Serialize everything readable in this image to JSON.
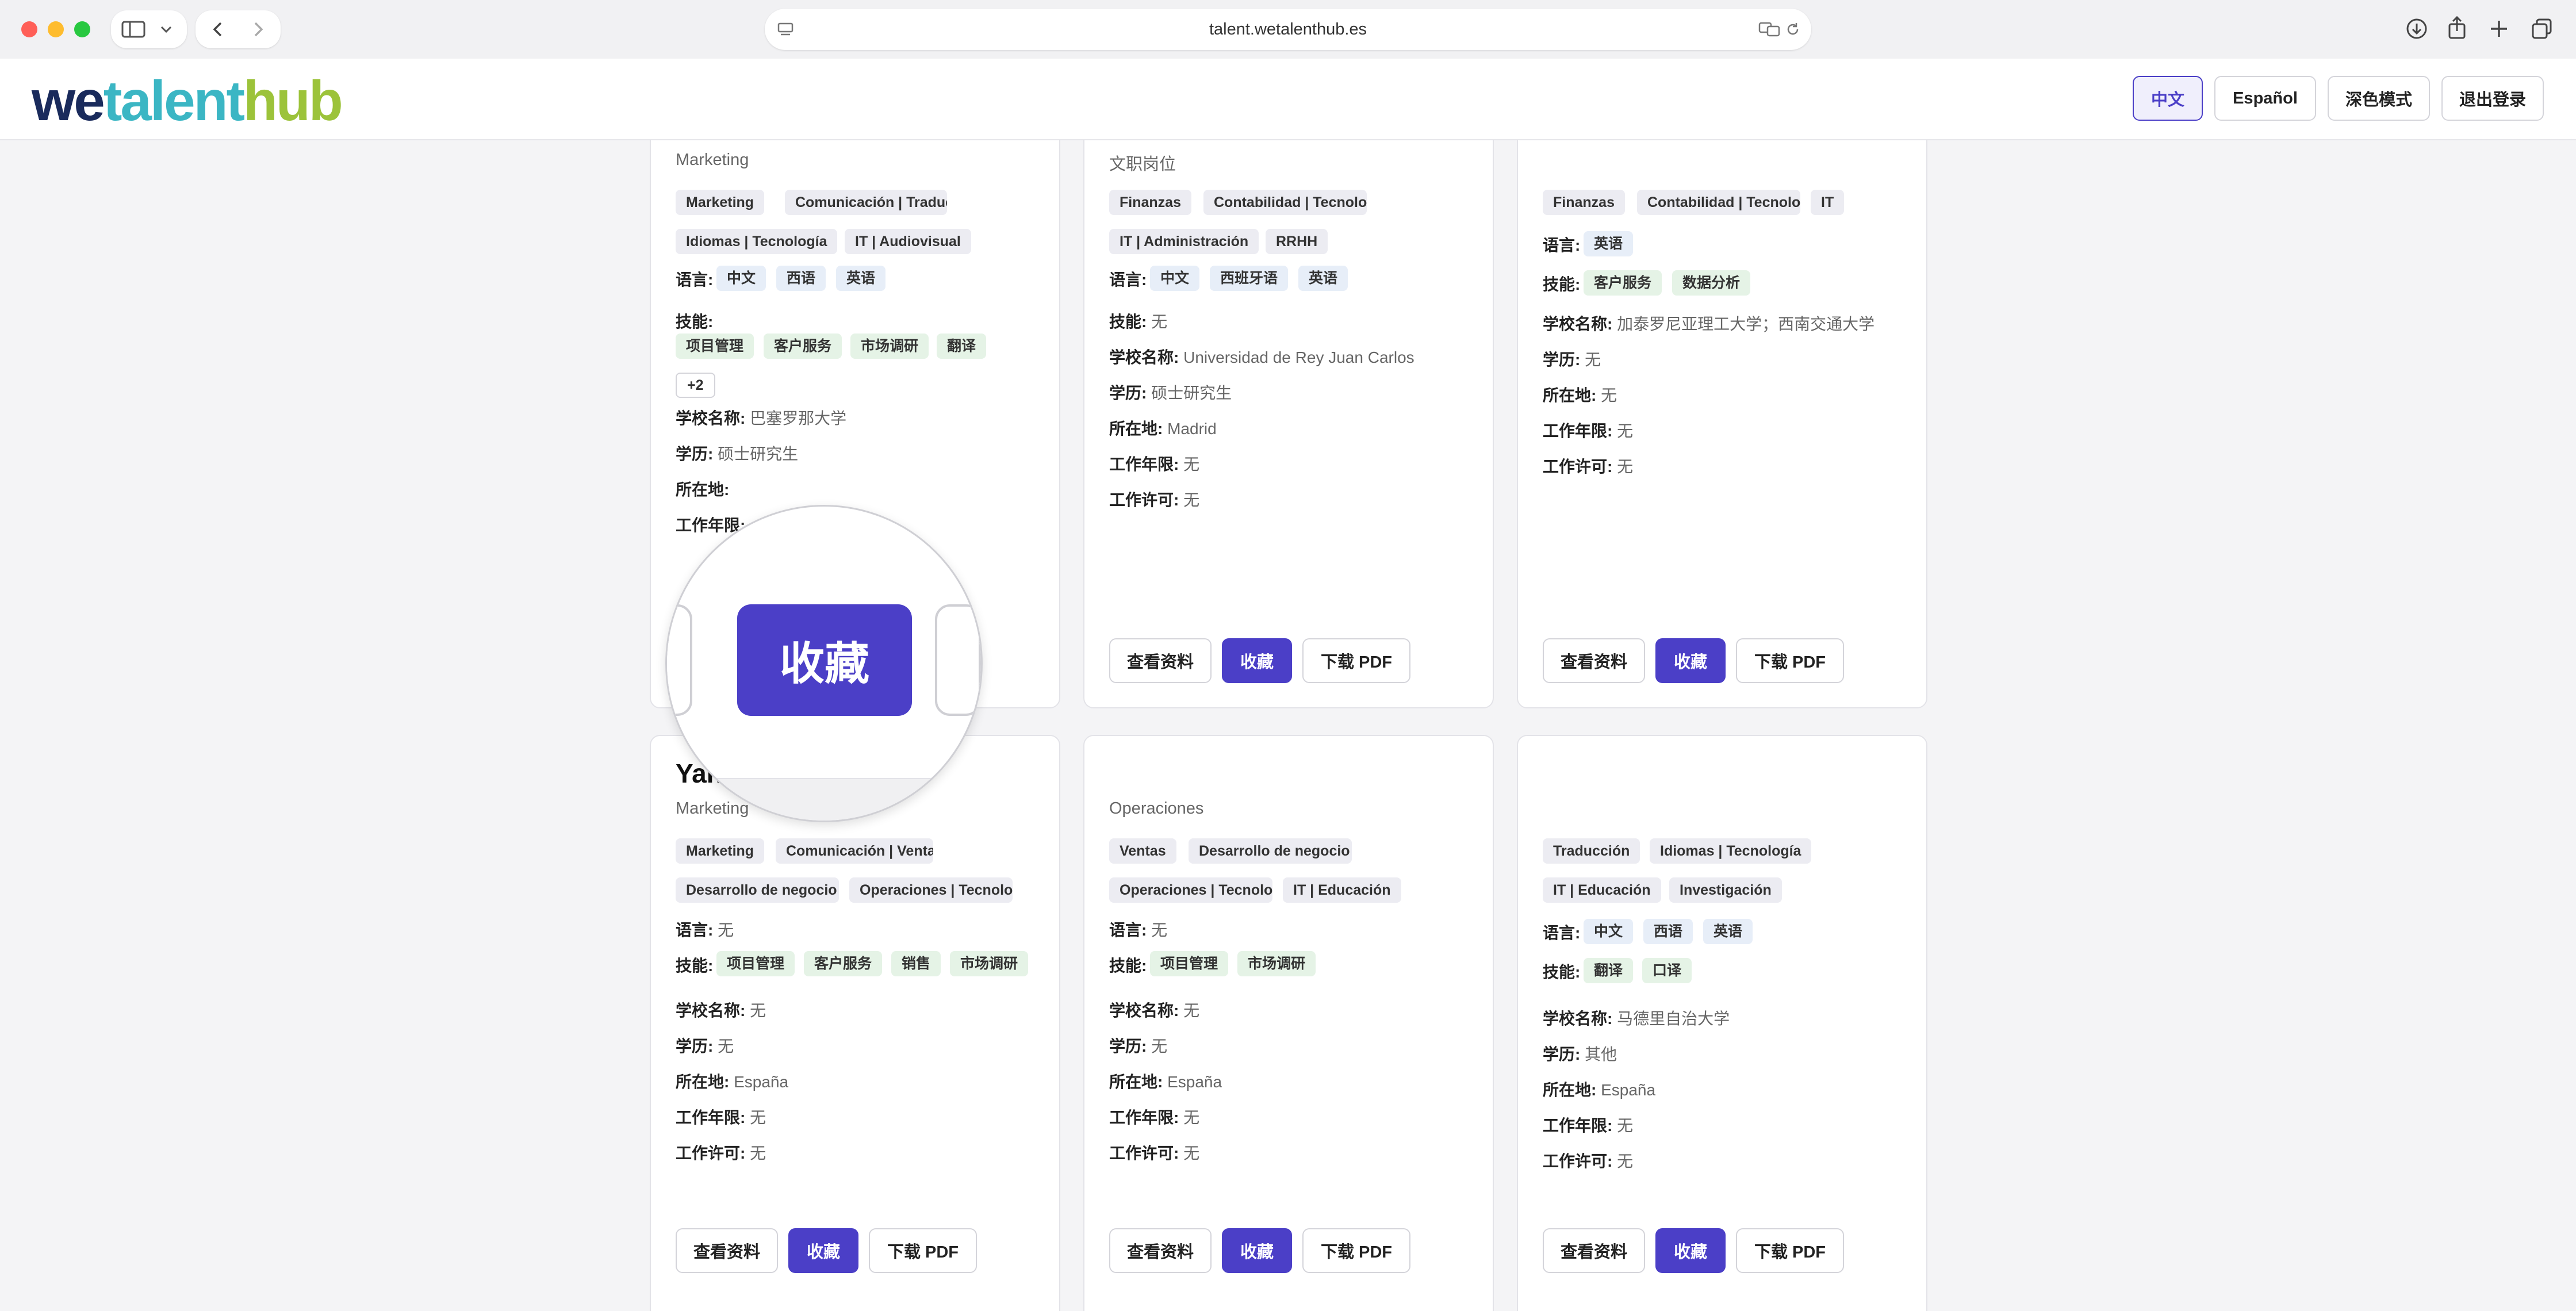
{
  "browser": {
    "url": "talent.wetalenthub.es"
  },
  "header": {
    "logo": {
      "part1": "we",
      "part2": "talent",
      "part3": "hub"
    },
    "buttons": {
      "lang_zh": "中文",
      "lang_es": "Español",
      "dark_mode": "深色模式",
      "logout": "退出登录"
    }
  },
  "labels": {
    "languages": "语言:",
    "skills": "技能:",
    "school": "学校名称:",
    "education": "学历:",
    "location": "所在地:",
    "experience": "工作年限:",
    "work_permit": "工作许可:",
    "view_profile": "查看资料",
    "favorite": "收藏",
    "download_pdf": "下载 PDF"
  },
  "magnifier": {
    "label": "收藏"
  },
  "cards": [
    {
      "role": "Marketing",
      "categories": [
        "Marketing",
        "Comunicación | Traducción",
        "Idiomas | Tecnología",
        "IT | Audiovisual"
      ],
      "languages": [
        "中文",
        "西语",
        "英语"
      ],
      "skills": [
        "项目管理",
        "客户服务",
        "市场调研",
        "翻译"
      ],
      "skills_more": "+2",
      "school": "巴塞罗那大学",
      "education": "硕士研究生",
      "location": "",
      "experience": "",
      "work_permit": ""
    },
    {
      "role": "文职岗位",
      "categories": [
        "Finanzas",
        "Contabilidad | Tecnología",
        "IT | Administración",
        "RRHH"
      ],
      "languages": [
        "中文",
        "西班牙语",
        "英语"
      ],
      "skills_text": "无",
      "school": "Universidad de Rey Juan Carlos",
      "education": "硕士研究生",
      "location": "Madrid",
      "experience": "无",
      "work_permit": "无"
    },
    {
      "role": "",
      "categories": [
        "Finanzas",
        "Contabilidad | Tecnología",
        "IT"
      ],
      "languages": [
        "英语"
      ],
      "skills": [
        "客户服务",
        "数据分析"
      ],
      "school": "加泰罗尼亚理工大学；西南交通大学",
      "education": "无",
      "location": "无",
      "experience": "无",
      "work_permit": "无"
    },
    {
      "name": "Yang",
      "role": "Marketing",
      "categories": [
        "Marketing",
        "Comunicación | Ventas",
        "Desarrollo de negocio",
        "Operaciones | Tecnología"
      ],
      "languages_text": "无",
      "skills": [
        "项目管理",
        "客户服务",
        "销售",
        "市场调研"
      ],
      "school": "无",
      "education": "无",
      "location": "España",
      "experience": "无",
      "work_permit": "无"
    },
    {
      "role": "Operaciones",
      "categories": [
        "Ventas",
        "Desarrollo de negocio",
        "Operaciones | Tecnología",
        "IT | Educación"
      ],
      "languages_text": "无",
      "skills": [
        "项目管理",
        "市场调研"
      ],
      "school": "无",
      "education": "无",
      "location": "España",
      "experience": "无",
      "work_permit": "无"
    },
    {
      "role": "",
      "categories": [
        "Traducción",
        "Idiomas | Tecnología",
        "IT | Educación",
        "Investigación"
      ],
      "languages": [
        "中文",
        "西语",
        "英语"
      ],
      "skills": [
        "翻译",
        "口译"
      ],
      "school": "马德里自治大学",
      "education": "其他",
      "location": "España",
      "experience": "无",
      "work_permit": "无"
    }
  ]
}
